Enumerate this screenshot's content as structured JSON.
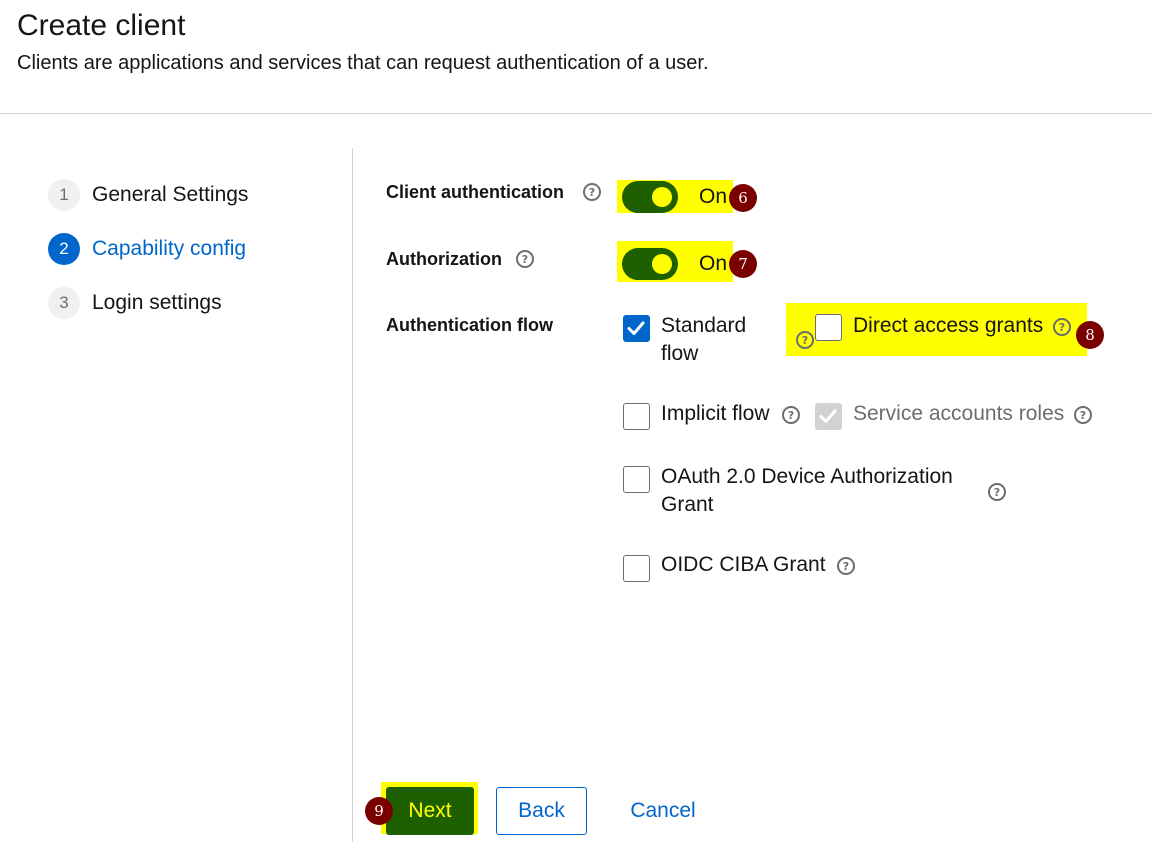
{
  "header": {
    "title": "Create client",
    "subtitle": "Clients are applications and services that can request authentication of a user."
  },
  "wizard": {
    "steps": [
      {
        "number": "1",
        "label": "General Settings",
        "active": false
      },
      {
        "number": "2",
        "label": "Capability config",
        "active": true
      },
      {
        "number": "3",
        "label": "Login settings",
        "active": false
      }
    ]
  },
  "form": {
    "client_authentication": {
      "label": "Client authentication",
      "state": "On",
      "badge": "6"
    },
    "authorization": {
      "label": "Authorization",
      "state": "On",
      "badge": "7"
    },
    "authentication_flow": {
      "label": "Authentication flow",
      "options": {
        "standard_flow": {
          "label_line1": "Standard",
          "label_line2": "flow",
          "checked": true
        },
        "direct_access_grants": {
          "label": "Direct access grants",
          "checked": false,
          "badge": "8"
        },
        "implicit_flow": {
          "label": "Implicit flow",
          "checked": false
        },
        "service_accounts_roles": {
          "label": "Service accounts roles",
          "checked": true,
          "disabled": true
        },
        "oauth_device": {
          "label_line1": "OAuth 2.0 Device Authorization",
          "label_line2": "Grant",
          "checked": false
        },
        "oidc_ciba": {
          "label": "OIDC CIBA Grant",
          "checked": false
        }
      }
    }
  },
  "footer": {
    "next_label": "Next",
    "back_label": "Back",
    "cancel_label": "Cancel",
    "next_badge": "9"
  },
  "help_icon": "?",
  "colors": {
    "accent_blue": "#0066cc",
    "highlight": "#ffff00",
    "toggle_on": "#1e5f00",
    "badge": "#7a0000"
  }
}
